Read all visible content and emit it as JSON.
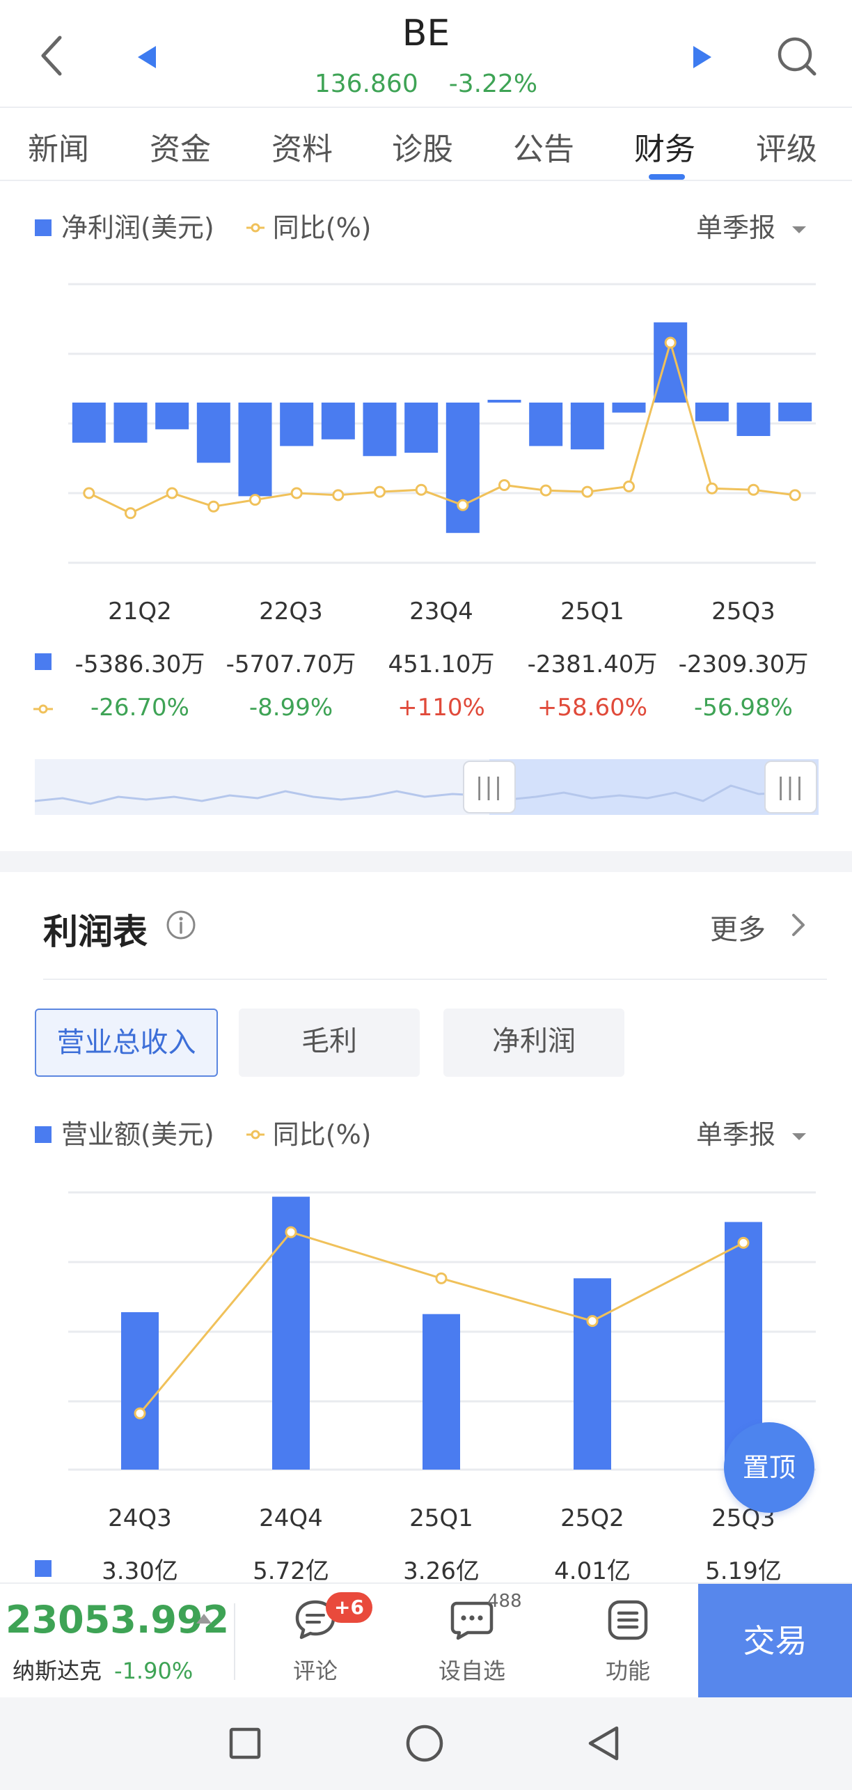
{
  "header": {
    "ticker": "BE",
    "price": "136.860",
    "change_pct": "-3.22%"
  },
  "tabs": [
    "新闻",
    "资金",
    "资料",
    "诊股",
    "公告",
    "财务",
    "评级"
  ],
  "active_tab": "财务",
  "net_profit": {
    "legend_bar": "净利润(美元)",
    "legend_line": "同比(%)",
    "period_selector": "单季报",
    "chart_data": {
      "type": "bar",
      "bar_values": [
        -0.6,
        -0.6,
        -0.4,
        -0.9,
        -1.4,
        -0.65,
        -0.55,
        -0.8,
        -0.75,
        -1.95,
        0.03,
        -0.65,
        -0.7,
        -0.15,
        1.2,
        -0.28,
        -0.5,
        -0.28
      ],
      "line_values": [
        0.0,
        -0.3,
        0.0,
        -0.2,
        -0.1,
        0.0,
        -0.03,
        0.02,
        0.05,
        -0.18,
        0.12,
        0.04,
        0.02,
        0.1,
        2.25,
        0.07,
        0.05,
        -0.03
      ],
      "x_labels": [
        "21Q2",
        "22Q3",
        "23Q4",
        "25Q1",
        "25Q3"
      ],
      "bar_labels": [
        "-5386.30万",
        "-5707.70万",
        "451.10万",
        "-2381.40万",
        "-2309.30万"
      ],
      "line_labels": [
        "-26.70%",
        "-8.99%",
        "+110%",
        "+58.60%",
        "-56.98%"
      ]
    },
    "slider": {
      "handle_glyph": "|||",
      "selected_range": [
        0.55,
        1.0
      ]
    }
  },
  "income": {
    "title": "利润表",
    "more_label": "更多",
    "buttons": [
      "营业总收入",
      "毛利",
      "净利润"
    ],
    "active_button": "营业总收入",
    "legend_bar": "营业额(美元)",
    "legend_line": "同比(%)",
    "period_selector": "单季报",
    "chart_data": {
      "type": "bar",
      "categories": [
        "24Q3",
        "24Q4",
        "25Q1",
        "25Q2",
        "25Q3"
      ],
      "values": [
        3.3,
        5.72,
        3.26,
        4.01,
        5.19
      ],
      "value_labels": [
        "3.30亿",
        "5.72亿",
        "3.26亿",
        "4.01亿",
        "5.19亿"
      ],
      "line_values": [
        0.4,
        2.95,
        2.3,
        1.7,
        2.8
      ]
    }
  },
  "fab_label": "置顶",
  "bottom_bar": {
    "index_value": "23053.992",
    "index_name": "纳斯达克",
    "index_change": "-1.90%",
    "actions": [
      {
        "label": "评论",
        "icon": "chat-icon"
      },
      {
        "label": "设自选",
        "icon": "more-dots-icon"
      },
      {
        "label": "功能",
        "icon": "menu-list-icon"
      }
    ],
    "comment_badge": "+6",
    "watchlist_count": "488",
    "trade_label": "交易"
  },
  "colors": {
    "bar": "#4a7cf0",
    "line": "#f0c15a",
    "up": "#e04a3a",
    "down": "#3ea355"
  }
}
